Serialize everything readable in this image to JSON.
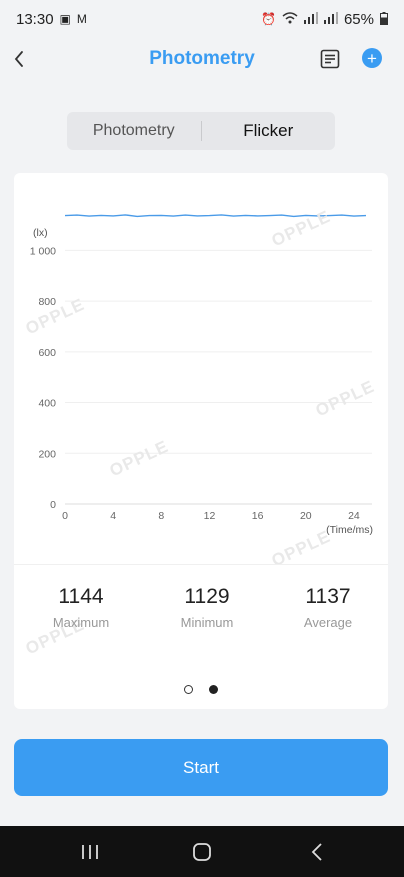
{
  "status_bar": {
    "time": "13:30",
    "battery": "65%"
  },
  "header": {
    "title": "Photometry"
  },
  "tabs": [
    {
      "label": "Photometry",
      "active": false
    },
    {
      "label": "Flicker",
      "active": true
    }
  ],
  "watermark_text": "OPPLE",
  "chart_data": {
    "type": "line",
    "ylabel": "(lx)",
    "xlabel": "(Time/ms)",
    "x_ticks": [
      "0",
      "4",
      "8",
      "12",
      "16",
      "20",
      "24"
    ],
    "y_ticks": [
      "0",
      "200",
      "400",
      "600",
      "800",
      "1 000"
    ],
    "ylim": [
      0,
      1100
    ],
    "xlim": [
      0,
      25.5
    ],
    "series": [
      {
        "color": "#4a9be8",
        "x": [
          0,
          1,
          2,
          3,
          4,
          5,
          6,
          7,
          8,
          9,
          10,
          11,
          12,
          13,
          14,
          15,
          16,
          17,
          18,
          19,
          20,
          21,
          22,
          23,
          24,
          25
        ],
        "y": [
          1137,
          1139,
          1135,
          1138,
          1136,
          1140,
          1134,
          1137,
          1138,
          1135,
          1139,
          1136,
          1137,
          1140,
          1135,
          1138,
          1136,
          1137,
          1139,
          1134,
          1138,
          1136,
          1137,
          1139,
          1135,
          1137
        ]
      }
    ],
    "grid": true
  },
  "stats": [
    {
      "value": "1144",
      "label": "Maximum"
    },
    {
      "value": "1129",
      "label": "Minimum"
    },
    {
      "value": "1137",
      "label": "Average"
    }
  ],
  "pager": {
    "pages": 2,
    "current": 2
  },
  "start_button": {
    "label": "Start"
  },
  "colors": {
    "accent": "#3a9cf2",
    "line": "#4a9be8"
  }
}
